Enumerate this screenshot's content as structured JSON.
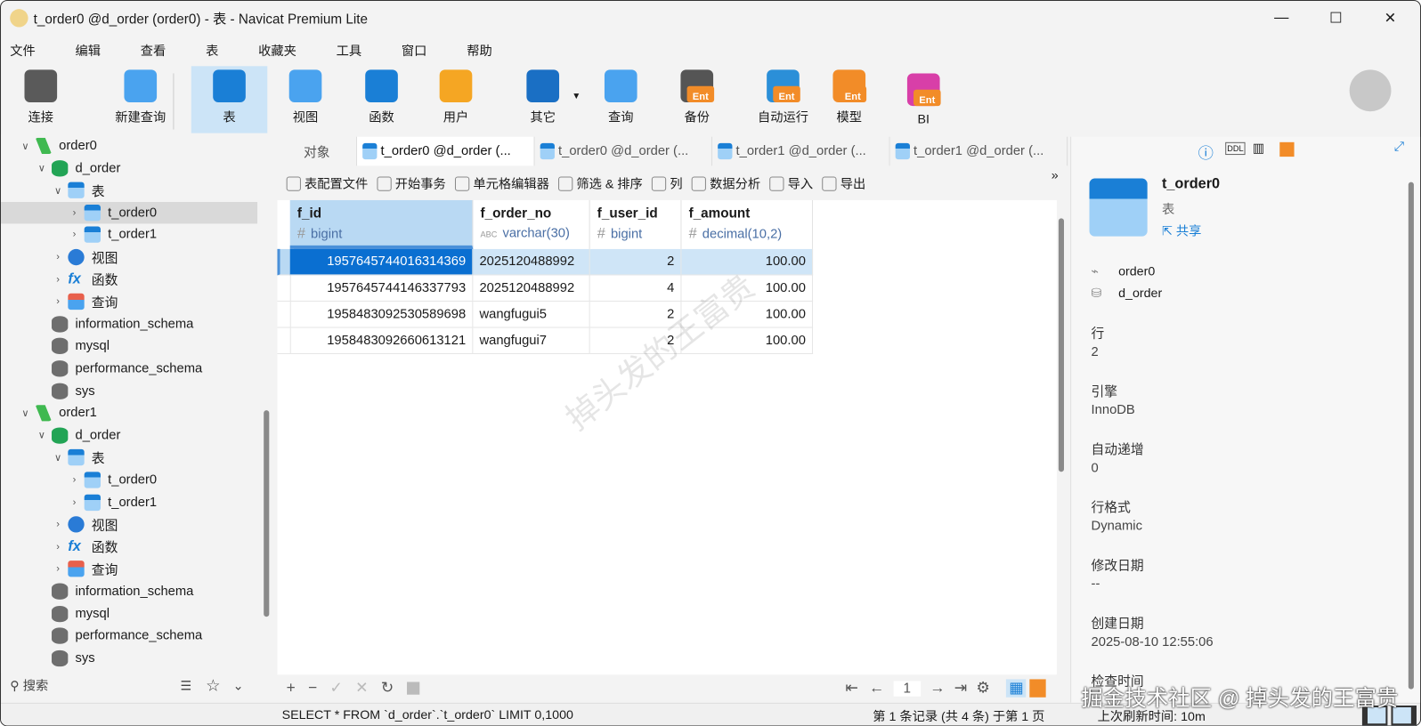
{
  "window": {
    "title": "t_order0 @d_order (order0) - 表 - Navicat Premium Lite",
    "minimize": "—",
    "maximize": "☐",
    "close": "✕"
  },
  "menu": [
    "文件",
    "编辑",
    "查看",
    "表",
    "收藏夹",
    "工具",
    "窗口",
    "帮助"
  ],
  "toolbar": [
    {
      "label": "连接",
      "icon": "plug-add-icon"
    },
    {
      "label": "新建查询",
      "icon": "new-query-icon"
    },
    {
      "label": "表",
      "icon": "table-icon",
      "active": true
    },
    {
      "label": "视图",
      "icon": "view-icon"
    },
    {
      "label": "函数",
      "icon": "function-icon"
    },
    {
      "label": "用户",
      "icon": "user-icon"
    },
    {
      "label": "其它",
      "icon": "tools-icon"
    },
    {
      "label": "查询",
      "icon": "query-icon"
    },
    {
      "label": "备份",
      "icon": "backup-icon",
      "badge": "Ent"
    },
    {
      "label": "自动运行",
      "icon": "robot-icon",
      "badge": "Ent"
    },
    {
      "label": "模型",
      "icon": "model-icon",
      "badge": "Ent"
    },
    {
      "label": "BI",
      "icon": "bi-icon",
      "badge": "Ent"
    }
  ],
  "sidebar": {
    "tree": [
      {
        "label": "order0",
        "type": "conn",
        "level": 0,
        "chev": "v"
      },
      {
        "label": "d_order",
        "type": "db",
        "level": 1,
        "chev": "v"
      },
      {
        "label": "表",
        "type": "tbl",
        "level": 2,
        "chev": "v"
      },
      {
        "label": "t_order0",
        "type": "tbl",
        "level": 3,
        "chev": ">",
        "selected": true
      },
      {
        "label": "t_order1",
        "type": "tbl",
        "level": 3,
        "chev": ">"
      },
      {
        "label": "视图",
        "type": "view",
        "level": 2,
        "chev": ">"
      },
      {
        "label": "函数",
        "type": "fx",
        "level": 2,
        "chev": ">"
      },
      {
        "label": "查询",
        "type": "q",
        "level": 2,
        "chev": ">"
      },
      {
        "label": "information_schema",
        "type": "dbg",
        "level": 1
      },
      {
        "label": "mysql",
        "type": "dbg",
        "level": 1
      },
      {
        "label": "performance_schema",
        "type": "dbg",
        "level": 1
      },
      {
        "label": "sys",
        "type": "dbg",
        "level": 1
      },
      {
        "label": "order1",
        "type": "conn",
        "level": 0,
        "chev": "v"
      },
      {
        "label": "d_order",
        "type": "db",
        "level": 1,
        "chev": "v"
      },
      {
        "label": "表",
        "type": "tbl",
        "level": 2,
        "chev": "v"
      },
      {
        "label": "t_order0",
        "type": "tbl",
        "level": 3,
        "chev": ">"
      },
      {
        "label": "t_order1",
        "type": "tbl",
        "level": 3,
        "chev": ">"
      },
      {
        "label": "视图",
        "type": "view",
        "level": 2,
        "chev": ">"
      },
      {
        "label": "函数",
        "type": "fx",
        "level": 2,
        "chev": ">"
      },
      {
        "label": "查询",
        "type": "q",
        "level": 2,
        "chev": ">"
      },
      {
        "label": "information_schema",
        "type": "dbg",
        "level": 1
      },
      {
        "label": "mysql",
        "type": "dbg",
        "level": 1
      },
      {
        "label": "performance_schema",
        "type": "dbg",
        "level": 1
      },
      {
        "label": "sys",
        "type": "dbg",
        "level": 1
      }
    ],
    "search_placeholder": "搜索"
  },
  "tabs": [
    {
      "label": "对象"
    },
    {
      "label": "t_order0 @d_order (...",
      "active": true
    },
    {
      "label": "t_order0 @d_order (..."
    },
    {
      "label": "t_order1 @d_order (..."
    },
    {
      "label": "t_order1 @d_order (..."
    }
  ],
  "subtoolbar": [
    "表配置文件",
    "开始事务",
    "单元格编辑器",
    "筛选 & 排序",
    "列",
    "数据分析",
    "导入",
    "导出"
  ],
  "grid": {
    "columns": [
      {
        "name": "f_id",
        "type": "bigint",
        "type_icon": "#"
      },
      {
        "name": "f_order_no",
        "type": "varchar(30)",
        "type_icon": "ABC"
      },
      {
        "name": "f_user_id",
        "type": "bigint",
        "type_icon": "#"
      },
      {
        "name": "f_amount",
        "type": "decimal(10,2)",
        "type_icon": "#"
      }
    ],
    "rows": [
      [
        "1957645744016314369",
        "2025120488992",
        "2",
        "100.00"
      ],
      [
        "1957645744146337793",
        "2025120488992",
        "4",
        "100.00"
      ],
      [
        "1958483092530589698",
        "wangfugui5",
        "2",
        "100.00"
      ],
      [
        "1958483092660613121",
        "wangfugui7",
        "2",
        "100.00"
      ]
    ]
  },
  "pager": {
    "page": "1"
  },
  "status": {
    "sql": "SELECT * FROM `d_order`.`t_order0` LIMIT 0,1000",
    "records": "第 1 条记录 (共 4 条) 于第 1 页",
    "refresh": "上次刷新时间: 10m"
  },
  "info": {
    "name": "t_order0",
    "kind": "表",
    "share": "共享",
    "conn": "order0",
    "db": "d_order",
    "fields": [
      {
        "label": "行",
        "value": "2"
      },
      {
        "label": "引擎",
        "value": "InnoDB"
      },
      {
        "label": "自动递增",
        "value": "0"
      },
      {
        "label": "行格式",
        "value": "Dynamic"
      },
      {
        "label": "修改日期",
        "value": "--"
      },
      {
        "label": "创建日期",
        "value": "2025-08-10 12:55:06"
      },
      {
        "label": "检查时间",
        "value": ""
      }
    ]
  },
  "watermark": "掉头发的王富贵",
  "footer_watermark": "掘金技术社区 @ 掉头发的王富贵",
  "colors": {
    "selection": "#0a6fd1",
    "accent": "#cce4f7",
    "ent": "#f28c28"
  }
}
